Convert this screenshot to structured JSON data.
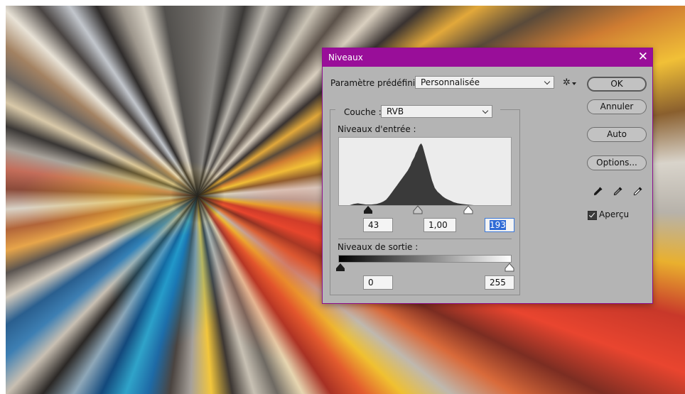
{
  "dialog": {
    "title": "Niveaux",
    "close_glyph": "✕",
    "accent_color": "#990e99",
    "preset": {
      "label": "Paramètre prédéfini :",
      "value": "Personnalisée"
    },
    "channel": {
      "label": "Couche :",
      "value": "RVB"
    },
    "input_levels": {
      "label": "Niveaux d'entrée :",
      "black": "43",
      "gamma": "1,00",
      "white": "193"
    },
    "output_levels": {
      "label": "Niveaux de sortie :",
      "black": "0",
      "white": "255"
    },
    "buttons": {
      "ok": "OK",
      "cancel": "Annuler",
      "auto": "Auto",
      "options": "Options..."
    },
    "preview": {
      "label": "Aperçu",
      "checked": true
    },
    "icons": [
      "gear-icon",
      "black-point-eyedropper-icon",
      "gray-point-eyedropper-icon",
      "white-point-eyedropper-icon"
    ]
  },
  "histogram": {
    "range": [
      0,
      255
    ],
    "bins": [
      [
        0,
        0
      ],
      [
        8,
        0
      ],
      [
        16,
        0
      ],
      [
        22,
        2
      ],
      [
        28,
        3
      ],
      [
        34,
        2
      ],
      [
        40,
        1
      ],
      [
        48,
        1
      ],
      [
        56,
        2
      ],
      [
        62,
        4
      ],
      [
        66,
        6
      ],
      [
        70,
        9
      ],
      [
        74,
        14
      ],
      [
        78,
        20
      ],
      [
        82,
        26
      ],
      [
        86,
        32
      ],
      [
        90,
        38
      ],
      [
        94,
        44
      ],
      [
        98,
        50
      ],
      [
        102,
        56
      ],
      [
        104,
        60
      ],
      [
        106,
        64
      ],
      [
        108,
        70
      ],
      [
        110,
        74
      ],
      [
        112,
        78
      ],
      [
        114,
        84
      ],
      [
        116,
        88
      ],
      [
        118,
        94
      ],
      [
        120,
        98
      ],
      [
        122,
        100
      ],
      [
        124,
        96
      ],
      [
        126,
        88
      ],
      [
        128,
        80
      ],
      [
        130,
        72
      ],
      [
        132,
        64
      ],
      [
        134,
        56
      ],
      [
        136,
        48
      ],
      [
        138,
        40
      ],
      [
        140,
        34
      ],
      [
        142,
        28
      ],
      [
        146,
        22
      ],
      [
        150,
        18
      ],
      [
        154,
        14
      ],
      [
        158,
        11
      ],
      [
        162,
        9
      ],
      [
        166,
        7
      ],
      [
        170,
        5
      ],
      [
        176,
        3
      ],
      [
        182,
        2
      ],
      [
        190,
        1
      ],
      [
        200,
        0
      ],
      [
        255,
        0
      ]
    ]
  }
}
